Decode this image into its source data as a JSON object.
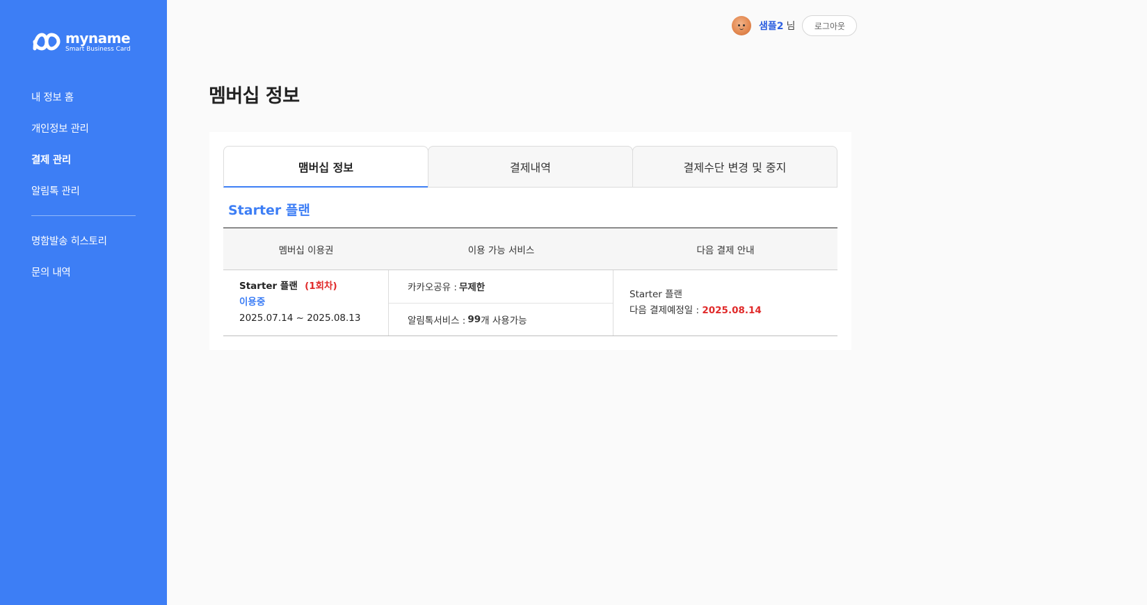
{
  "brand": {
    "name": "myname",
    "tagline": "Smart Business Card"
  },
  "sidebar": {
    "items": [
      {
        "label": "내 정보 홈"
      },
      {
        "label": "개인정보 관리"
      },
      {
        "label": "결제 관리",
        "active": true
      },
      {
        "label": "알림톡 관리"
      },
      {
        "label": "명함발송 히스토리"
      },
      {
        "label": "문의 내역"
      }
    ]
  },
  "header": {
    "user_name": "샘플2",
    "user_suffix": "님",
    "logout_label": "로그아웃"
  },
  "page": {
    "title": "멤버십 정보"
  },
  "tabs": [
    {
      "label": "맴버십 정보",
      "active": true
    },
    {
      "label": "결제내역"
    },
    {
      "label": "결제수단 변경 및 중지"
    }
  ],
  "plan": {
    "title": "Starter 플랜",
    "columns": [
      "멤버십 이용권",
      "이용 가능 서비스",
      "다음 결제 안내"
    ],
    "membership": {
      "name": "Starter 플랜",
      "cycle": "(1회차)",
      "status": "이용중",
      "period": "2025.07.14 ~ 2025.08.13"
    },
    "services": {
      "kakao_label": "카카오공유 : ",
      "kakao_value": "무제한",
      "alimtalk_label": "알림톡서비스 : ",
      "alimtalk_count": "99",
      "alimtalk_suffix": "개 사용가능"
    },
    "next_payment": {
      "plan_name": "Starter 플랜",
      "date_label": "다음 결제예정일 : ",
      "date_value": "2025.08.14"
    }
  },
  "colors": {
    "sidebar_bg": "#3d7ef5",
    "accent_blue": "#3d7ef5",
    "accent_red": "#e02a2a"
  }
}
